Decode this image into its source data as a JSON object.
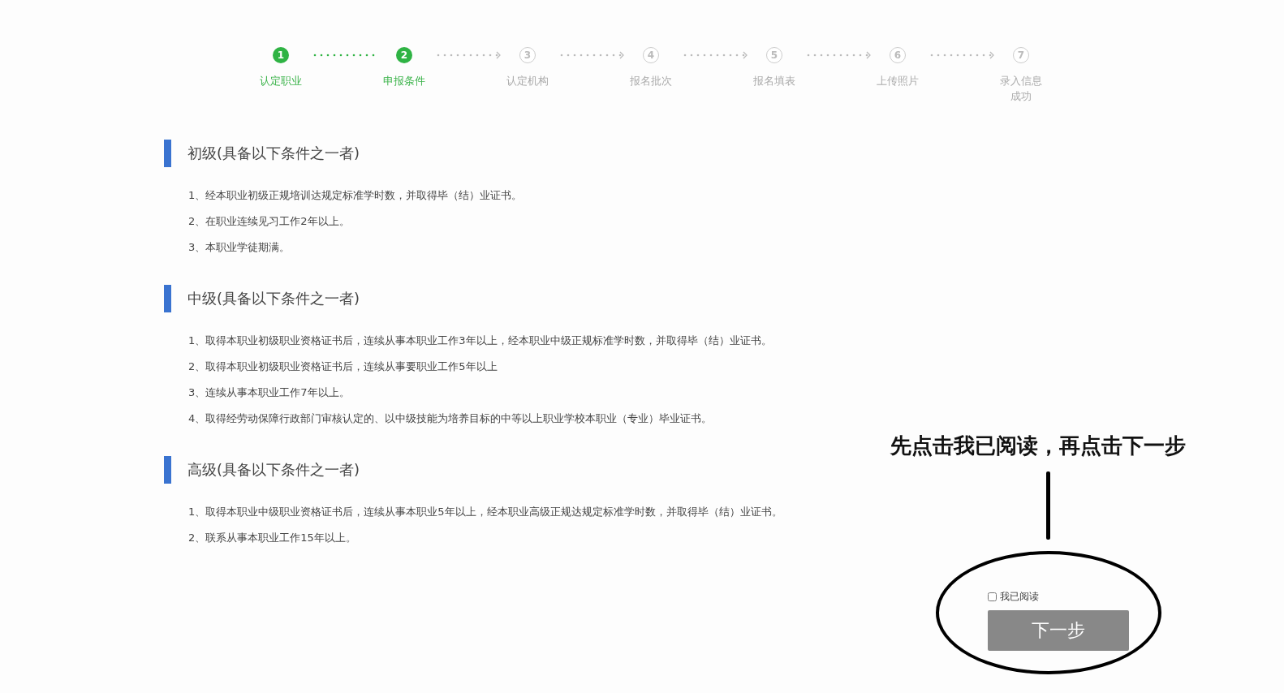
{
  "steps": [
    {
      "number": "1",
      "label": "认定职业",
      "done": true
    },
    {
      "number": "2",
      "label": "申报条件",
      "done": true
    },
    {
      "number": "3",
      "label": "认定机构",
      "done": false
    },
    {
      "number": "4",
      "label": "报名批次",
      "done": false
    },
    {
      "number": "5",
      "label": "报名填表",
      "done": false
    },
    {
      "number": "6",
      "label": "上传照片",
      "done": false
    },
    {
      "number": "7",
      "label": "录入信息成功",
      "done": false
    }
  ],
  "sections": [
    {
      "title": "初级(具备以下条件之一者)",
      "items": [
        "1、经本职业初级正规培训达规定标准学时数，并取得毕（结）业证书。",
        "2、在职业连续见习工作2年以上。",
        "3、本职业学徒期满。"
      ]
    },
    {
      "title": "中级(具备以下条件之一者)",
      "items": [
        "1、取得本职业初级职业资格证书后，连续从事本职业工作3年以上，经本职业中级正规标准学时数，并取得毕（结）业证书。",
        "2、取得本职业初级职业资格证书后，连续从事要职业工作5年以上",
        "3、连续从事本职业工作7年以上。",
        "4、取得经劳动保障行政部门审核认定的、以中级技能为培养目标的中等以上职业学校本职业（专业）毕业证书。"
      ]
    },
    {
      "title": "高级(具备以下条件之一者)",
      "items": [
        "1、取得本职业中级职业资格证书后，连续从事本职业5年以上，经本职业高级正规达规定标准学时数，并取得毕（结）业证书。",
        "2、联系从事本职业工作15年以上。"
      ]
    }
  ],
  "annotation": {
    "text": "先点击我已阅读，再点击下一步"
  },
  "agreement": {
    "label": "我已阅读",
    "checked": false
  },
  "next_button": {
    "label": "下一步",
    "disabled": true
  }
}
